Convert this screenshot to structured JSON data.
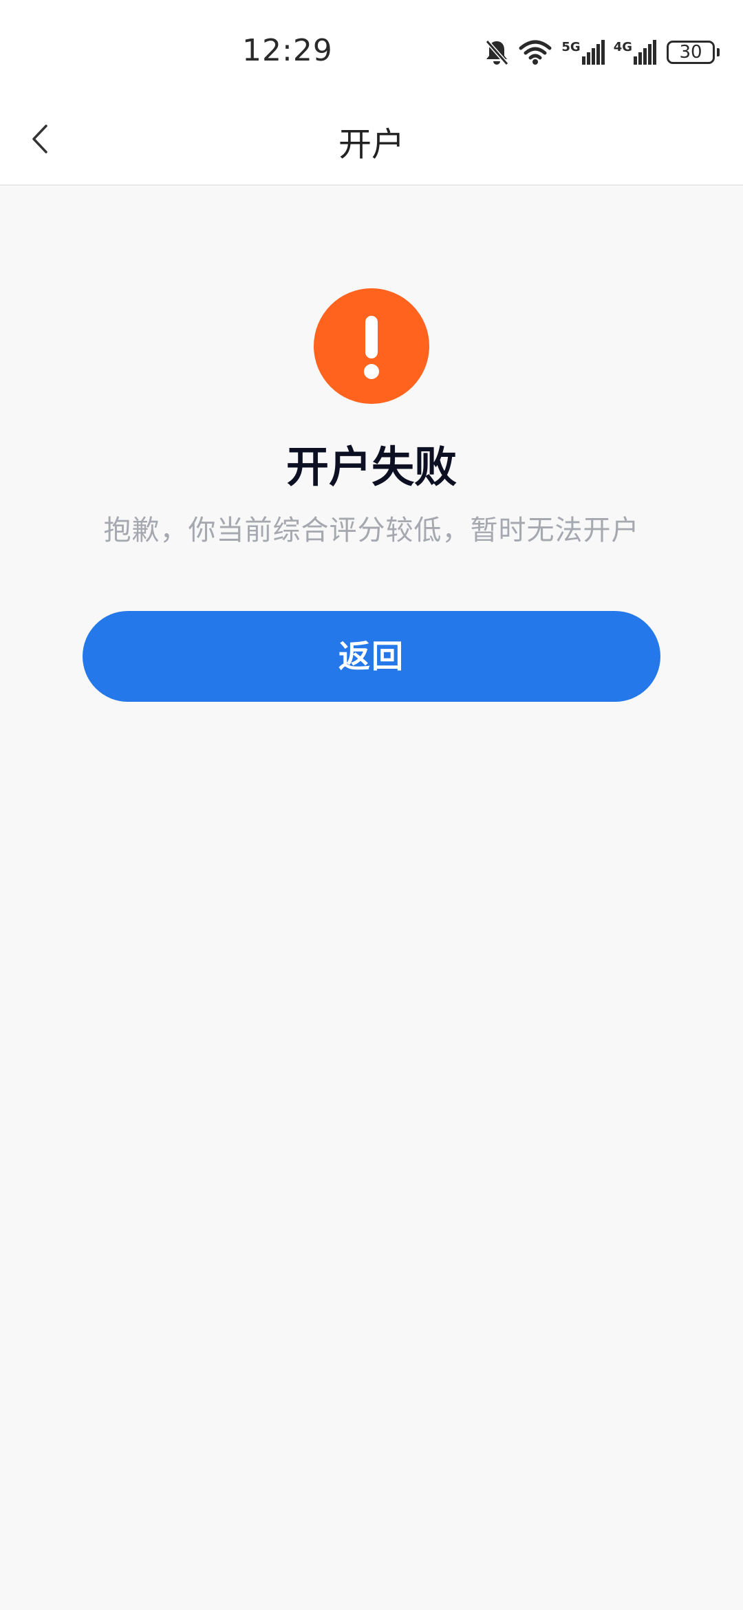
{
  "status_bar": {
    "time": "12:29",
    "icons": [
      "bell-muted-icon",
      "wifi-icon",
      "signal-5g-icon",
      "signal-4g-icon",
      "battery-icon"
    ],
    "network_1": "5G",
    "network_2": "4G",
    "battery_level": "30"
  },
  "nav": {
    "back_icon": "chevron-left-icon",
    "title": "开户"
  },
  "result": {
    "icon": "exclamation-icon",
    "icon_color": "#ff631e",
    "title": "开户失败",
    "description": "抱歉，你当前综合评分较低，暂时无法开户"
  },
  "actions": {
    "back_label": "返回",
    "button_color": "#2478ea"
  }
}
